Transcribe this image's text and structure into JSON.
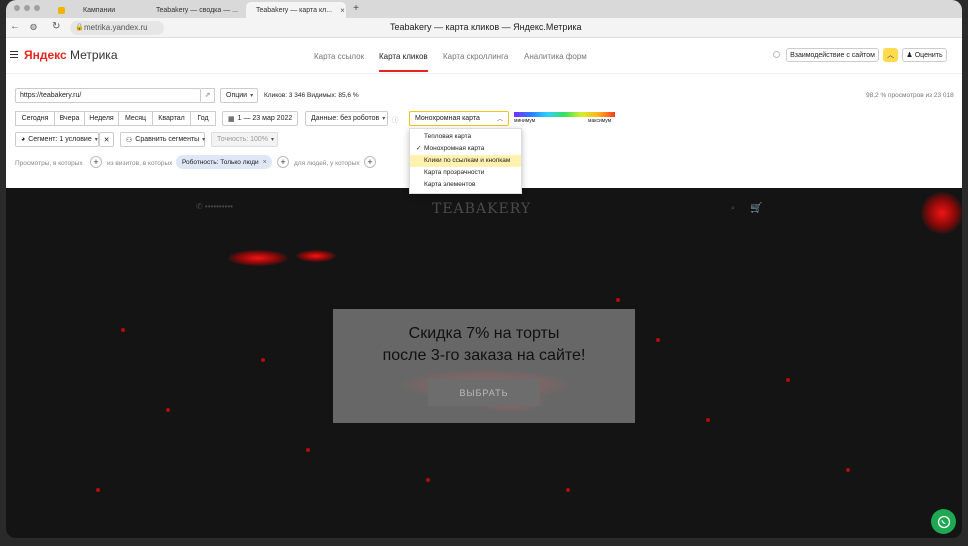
{
  "browser": {
    "tabs": [
      {
        "label": "Кампании"
      },
      {
        "label": "Teabakery — сводка — ..."
      },
      {
        "label": "Teabakery — карта кл..."
      }
    ],
    "url": "metrika.yandex.ru",
    "window_title": "Teabakery — карта кликов — Яндекс.Метрика"
  },
  "header": {
    "logo_ya": "Яндекс",
    "logo_rest": " Метрика",
    "nav": [
      "Карта ссылок",
      "Карта кликов",
      "Карта скроллинга",
      "Аналитика форм"
    ],
    "active_nav": "Карта кликов",
    "interaction_button": "Взаимодействие с сайтом",
    "rate_button": "Оценить"
  },
  "toolbar": {
    "page_url": "https://teabakery.ru/",
    "options_label": "Опции",
    "clicks_stat": "Кликов: 3 346",
    "visible_stat": "Видимых: 85,6 %",
    "views_stat": "98,2 % просмотров из 23 018",
    "periods": [
      "Сегодня",
      "Вчера",
      "Неделя",
      "Месяц",
      "Квартал",
      "Год"
    ],
    "date_range": "1 — 23 мар 2022",
    "data_filter": "Данные: без роботов",
    "map_type": "Монохромная карта",
    "legend_min": "минимум",
    "legend_max": "максимум",
    "segment_label": "Сегмент: 1 условие",
    "compare_label": "Сравнить сегменты",
    "accuracy_label": "Точность: 100%",
    "filter_views": "Просмотры, в которых",
    "filter_visits": "из визитов, в которых",
    "filter_people": "для людей, у которых",
    "robot_chip": "Роботность: Только люди",
    "colors": {
      "accent": "#e52620",
      "yellow": "#ffdb4d"
    }
  },
  "dropdown": {
    "items": [
      "Тепловая карта",
      "Монохромная карта",
      "Клики по ссылкам и кнопкам",
      "Карта прозрачности",
      "Карта элементов"
    ],
    "checked": "Монохромная карта",
    "hovered": "Клики по ссылкам и кнопкам"
  },
  "site": {
    "brand": "TEABAKERY",
    "popup_line1": "Скидка 7% на торты",
    "popup_line2": "после 3-го заказа на сайте!",
    "popup_button": "ВЫБРАТЬ"
  }
}
